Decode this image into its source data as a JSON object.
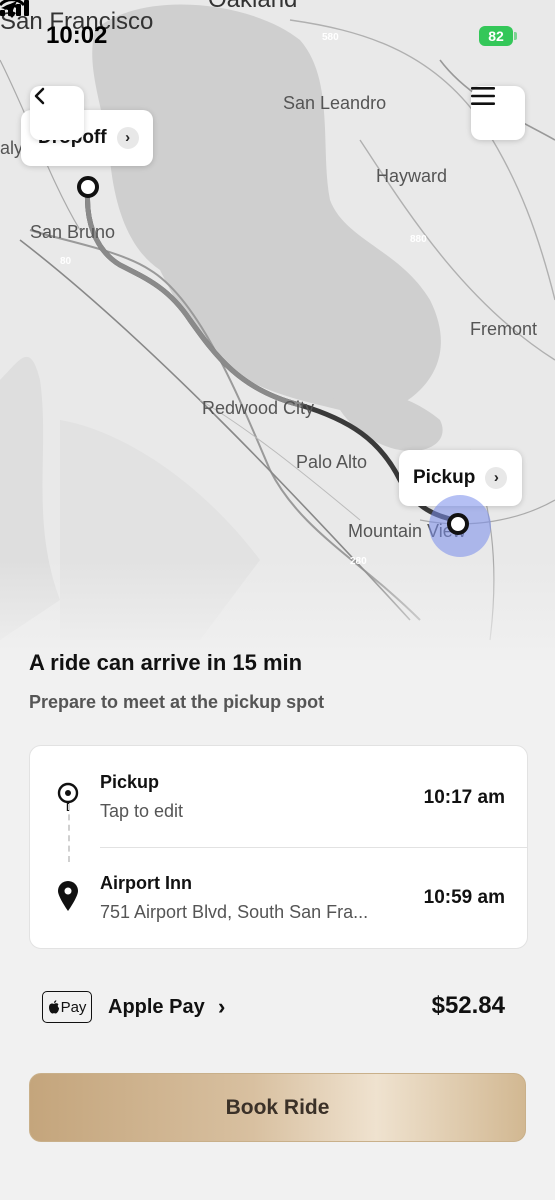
{
  "status_bar": {
    "time": "10:02",
    "battery": "82"
  },
  "map": {
    "cities": {
      "san_francisco": "San Francisco",
      "oakland": "Oakland",
      "san_leandro": "San Leandro",
      "hayward": "Hayward",
      "san_bruno": "San Bruno",
      "fremont": "Fremont",
      "redwood_city": "Redwood City",
      "palo_alto": "Palo Alto",
      "mountain_view": "Mountain View",
      "daly": "aly"
    },
    "highways": {
      "h580": "580",
      "h880": "880",
      "h280": "280",
      "h380": "80"
    },
    "dropoff_label": "Dropoff",
    "pickup_label": "Pickup",
    "icons": {
      "back": "chevron-left-icon",
      "menu": "hamburger-menu-icon"
    }
  },
  "summary": {
    "headline": "A ride can arrive in 15 min",
    "subline": "Prepare to meet at the pickup spot"
  },
  "trip": {
    "pickup": {
      "title": "Pickup",
      "subtitle": "Tap to edit",
      "time": "10:17 am"
    },
    "dropoff": {
      "title": "Airport Inn",
      "subtitle": "751 Airport Blvd, South San Fra...",
      "time": "10:59 am"
    }
  },
  "payment": {
    "logo_text": "Pay",
    "method": "Apple Pay",
    "price": "$52.84"
  },
  "book_button": "Book Ride",
  "colors": {
    "battery": "#34c759",
    "accent_gold": "#c4a57c",
    "route": "#333333",
    "pickup_halo": "#7f8de8"
  }
}
